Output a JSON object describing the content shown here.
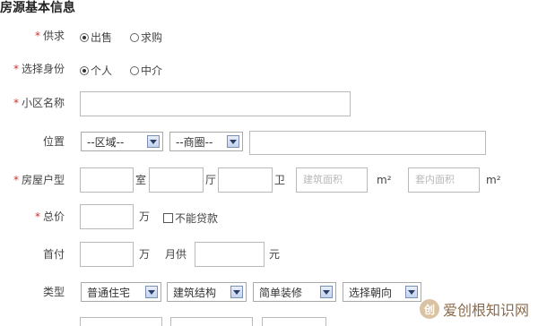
{
  "section_title": "房源基本信息",
  "labels": {
    "supply": "供求",
    "identity": "选择身份",
    "community": "小区名称",
    "location": "位置",
    "layout": "房屋户型",
    "total_price": "总价",
    "down_payment": "首付",
    "type": "类型"
  },
  "required_mark": "*",
  "supply_options": [
    "出售",
    "求购"
  ],
  "identity_options": [
    "个人",
    "中介"
  ],
  "location": {
    "region": "--区域--",
    "business": "--商圈--"
  },
  "layout_units": {
    "room": "室",
    "hall": "厅",
    "bath": "卫"
  },
  "area": {
    "build_placeholder": "建筑面积",
    "inner_placeholder": "套内面积",
    "unit": "m²"
  },
  "price": {
    "unit": "万",
    "no_loan": "不能贷款"
  },
  "down_payment": {
    "unit": "万",
    "monthly_label": "月供",
    "monthly_unit": "元"
  },
  "type_selects": [
    "普通住宅",
    "建筑结构",
    "简单装修",
    "选择朝向"
  ],
  "watermark": {
    "text": "爱创根知识网",
    "logo": "创"
  },
  "icons": {
    "dropdown": "chevron-down-icon",
    "radio": "radio-icon",
    "checkbox": "checkbox-icon"
  }
}
